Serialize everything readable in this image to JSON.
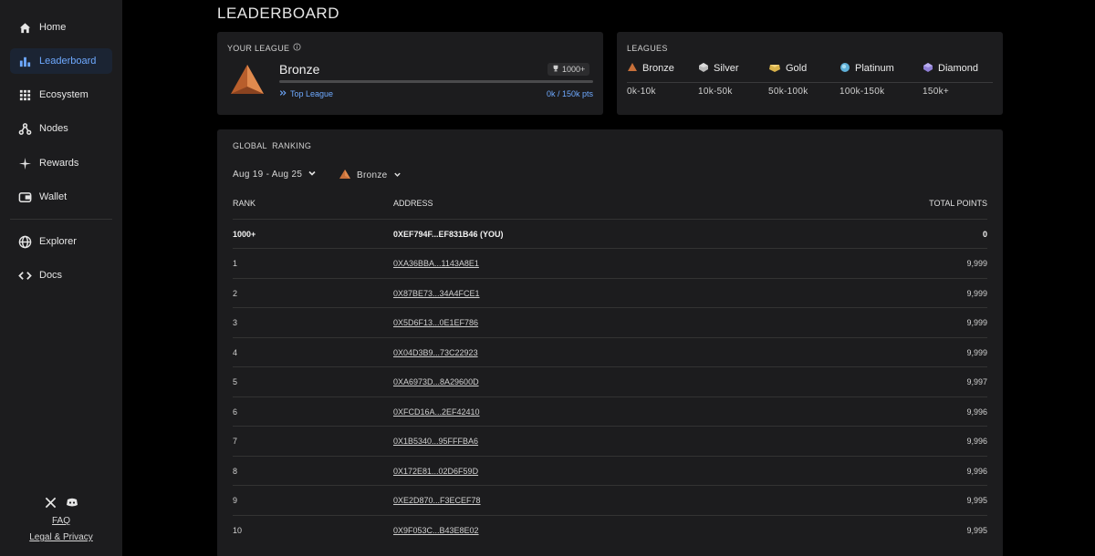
{
  "sidebar": {
    "items": [
      {
        "label": "Home",
        "icon": "home-icon"
      },
      {
        "label": "Leaderboard",
        "icon": "bar-chart-icon",
        "active": true
      },
      {
        "label": "Ecosystem",
        "icon": "grid-icon"
      },
      {
        "label": "Nodes",
        "icon": "nodes-icon"
      },
      {
        "label": "Rewards",
        "icon": "sparkle-icon"
      },
      {
        "label": "Wallet",
        "icon": "wallet-icon"
      },
      {
        "label": "Explorer",
        "icon": "globe-icon"
      },
      {
        "label": "Docs",
        "icon": "code-icon"
      }
    ],
    "faq": "FAQ",
    "legal": "Legal & Privacy",
    "social": [
      "x-icon",
      "discord-icon"
    ]
  },
  "page_title": "LEADERBOARD",
  "your_league": {
    "label": "YOUR LEAGUE",
    "name": "Bronze",
    "rank_badge": "1000+",
    "top_league": "Top League",
    "points": "0k / 150k pts",
    "progress": 0
  },
  "leagues": {
    "label": "LEAGUES",
    "items": [
      {
        "name": "Bronze",
        "range": "0k-10k",
        "color": "#c8703a"
      },
      {
        "name": "Silver",
        "range": "10k-50k",
        "color": "#b9b9b9"
      },
      {
        "name": "Gold",
        "range": "50k-100k",
        "color": "#d9b24a"
      },
      {
        "name": "Platinum",
        "range": "100k-150k",
        "color": "#5fb0d8"
      },
      {
        "name": "Diamond",
        "range": "150k+",
        "color": "#8f7fd6"
      }
    ]
  },
  "ranking": {
    "label": "GLOBAL  RANKING",
    "date_filter": "Aug 19 - Aug 25",
    "league_filter": "Bronze",
    "columns": {
      "rank": "RANK",
      "address": "ADDRESS",
      "points": "TOTAL POINTS"
    },
    "you": {
      "rank": "1000+",
      "address": "0XEF794F...EF831B46 (YOU)",
      "points": "0"
    },
    "rows": [
      {
        "rank": "1",
        "address": "0XA36BBA...1143A8E1",
        "points": "9,999"
      },
      {
        "rank": "2",
        "address": "0X87BE73...34A4FCE1",
        "points": "9,999"
      },
      {
        "rank": "3",
        "address": "0X5D6F13...0E1EF786",
        "points": "9,999"
      },
      {
        "rank": "4",
        "address": "0X04D3B9...73C22923",
        "points": "9,999"
      },
      {
        "rank": "5",
        "address": "0XA6973D...8A29600D",
        "points": "9,997"
      },
      {
        "rank": "6",
        "address": "0XFCD16A...2EF42410",
        "points": "9,996"
      },
      {
        "rank": "7",
        "address": "0X1B5340...95FFFBA6",
        "points": "9,996"
      },
      {
        "rank": "8",
        "address": "0X172E81...02D6F59D",
        "points": "9,996"
      },
      {
        "rank": "9",
        "address": "0XE2D870...F3ECEF78",
        "points": "9,995"
      },
      {
        "rank": "10",
        "address": "0X9F053C...B43E8E02",
        "points": "9,995"
      }
    ]
  },
  "colors": {
    "accent": "#6ea9ff",
    "bronze": "#c8703a"
  }
}
